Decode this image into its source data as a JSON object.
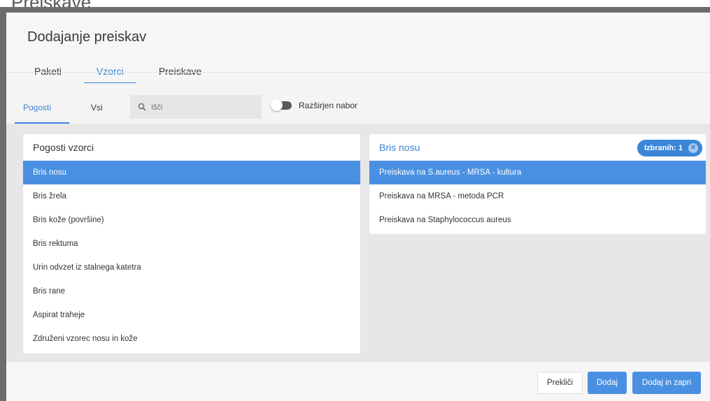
{
  "background": {
    "title": "Preiskave"
  },
  "modal": {
    "title": "Dodajanje preiskav",
    "tabs": [
      {
        "label": "Paketi",
        "active": false
      },
      {
        "label": "Vzorci",
        "active": true
      },
      {
        "label": "Preiskave",
        "active": false
      }
    ],
    "sub_tabs": [
      {
        "label": "Pogosti",
        "active": true
      },
      {
        "label": "Vsi",
        "active": false
      }
    ],
    "search": {
      "placeholder": "Išči",
      "value": ""
    },
    "toggle": {
      "label": "Razširjen nabor",
      "on": false
    }
  },
  "left_panel": {
    "title": "Pogosti vzorci",
    "items": [
      "Bris nosu",
      "Bris žrela",
      "Bris kože (površine)",
      "Bris rektuma",
      "Urin odvzet iz stalnega katetra",
      "Bris rane",
      "Aspirat traheje",
      "Združeni vzorec nosu in kože"
    ],
    "selected_index": 0
  },
  "right_panel": {
    "title": "Bris nosu",
    "badge": "Izbranih: 1",
    "items": [
      "Preiskava na S.aureus - MRSA - kultura",
      "Preiskava na MRSA - metoda PCR",
      "Preiskava na Staphylococcus aureus"
    ],
    "selected_index": 0
  },
  "footer": {
    "cancel_label": "Prekliči",
    "add_label": "Dodaj",
    "add_close_label": "Dodaj in zapri"
  },
  "colors": {
    "accent": "#4a90e2",
    "accent_text": "#3b86d9"
  }
}
